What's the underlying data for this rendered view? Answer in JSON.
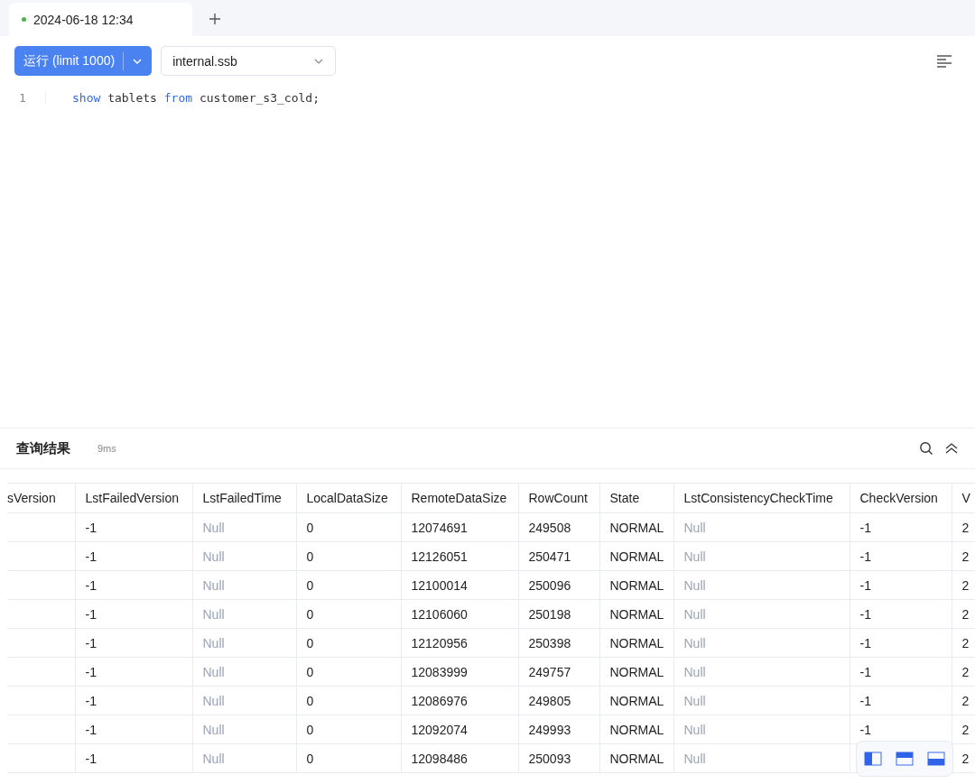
{
  "tabs": [
    {
      "label": "2024-06-18 12:34",
      "selected": true,
      "running": true
    }
  ],
  "toolbar": {
    "run_button": "运行 (limit 1000)",
    "database": "internal.ssb"
  },
  "editor": {
    "lines": [
      {
        "number": "1",
        "tokens": [
          {
            "text": "show",
            "kind": "keyword"
          },
          {
            "text": " tablets ",
            "kind": "plain"
          },
          {
            "text": "from",
            "kind": "keyword"
          },
          {
            "text": " customer_s3_cold;",
            "kind": "plain"
          }
        ]
      }
    ]
  },
  "results": {
    "title": "查询结果",
    "duration": "9ms",
    "columns": [
      "sVersion",
      "LstFailedVersion",
      "LstFailedTime",
      "LocalDataSize",
      "RemoteDataSize",
      "RowCount",
      "State",
      "LstConsistencyCheckTime",
      "CheckVersion",
      "V"
    ],
    "rows": [
      [
        null,
        "-1",
        {
          "text": "Null",
          "dimmed": true
        },
        "0",
        "12074691",
        "249508",
        "NORMAL",
        {
          "text": "Null",
          "dimmed": true
        },
        "-1",
        "2"
      ],
      [
        null,
        "-1",
        {
          "text": "Null",
          "dimmed": true
        },
        "0",
        "12126051",
        "250471",
        "NORMAL",
        {
          "text": "Null",
          "dimmed": true
        },
        "-1",
        "2"
      ],
      [
        null,
        "-1",
        {
          "text": "Null",
          "dimmed": true
        },
        "0",
        "12100014",
        "250096",
        "NORMAL",
        {
          "text": "Null",
          "dimmed": true
        },
        "-1",
        "2"
      ],
      [
        null,
        "-1",
        {
          "text": "Null",
          "dimmed": true
        },
        "0",
        "12106060",
        "250198",
        "NORMAL",
        {
          "text": "Null",
          "dimmed": true
        },
        "-1",
        "2"
      ],
      [
        null,
        "-1",
        {
          "text": "Null",
          "dimmed": true
        },
        "0",
        "12120956",
        "250398",
        "NORMAL",
        {
          "text": "Null",
          "dimmed": true
        },
        "-1",
        "2"
      ],
      [
        null,
        "-1",
        {
          "text": "Null",
          "dimmed": true
        },
        "0",
        "12083999",
        "249757",
        "NORMAL",
        {
          "text": "Null",
          "dimmed": true
        },
        "-1",
        "2"
      ],
      [
        null,
        "-1",
        {
          "text": "Null",
          "dimmed": true
        },
        "0",
        "12086976",
        "249805",
        "NORMAL",
        {
          "text": "Null",
          "dimmed": true
        },
        "-1",
        "2"
      ],
      [
        null,
        "-1",
        {
          "text": "Null",
          "dimmed": true
        },
        "0",
        "12092074",
        "249993",
        "NORMAL",
        {
          "text": "Null",
          "dimmed": true
        },
        "-1",
        "2"
      ],
      [
        null,
        "-1",
        {
          "text": "Null",
          "dimmed": true
        },
        "0",
        "12098486",
        "250093",
        "NORMAL",
        {
          "text": "Null",
          "dimmed": true
        },
        null,
        "2"
      ]
    ]
  }
}
